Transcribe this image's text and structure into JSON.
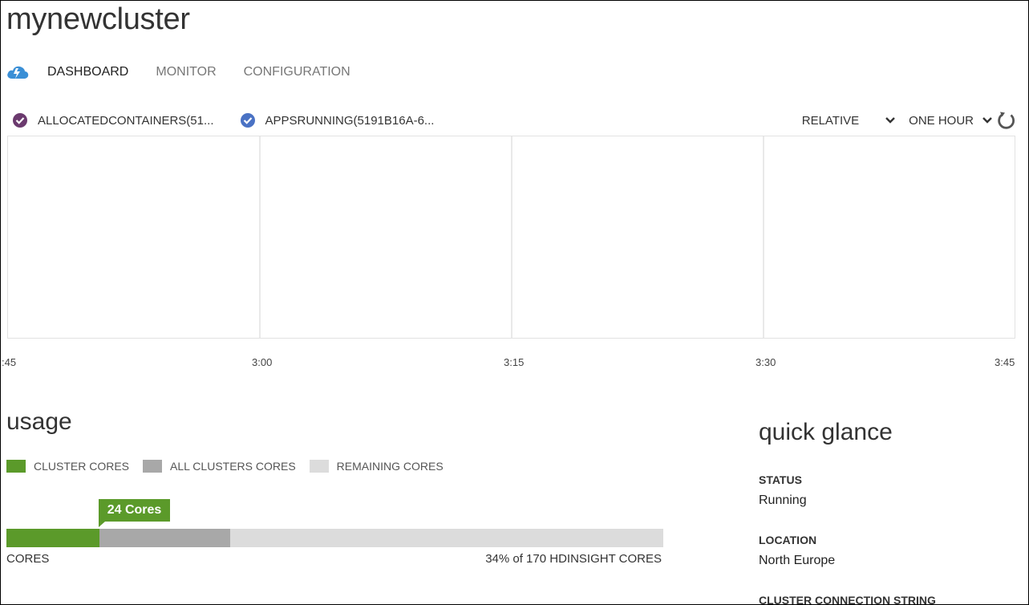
{
  "cluster": {
    "name": "mynewcluster"
  },
  "nav": {
    "tabs": [
      {
        "label": "DASHBOARD",
        "active": true
      },
      {
        "label": "MONITOR",
        "active": false
      },
      {
        "label": "CONFIGURATION",
        "active": false
      }
    ]
  },
  "metrics": [
    {
      "label": "ALLOCATEDCONTAINERS(51...",
      "color": "#6b3a6e"
    },
    {
      "label": "APPSRUNNING(5191B16A-6...",
      "color": "#4a72c4"
    }
  ],
  "controls": {
    "scale": "RELATIVE",
    "range": "ONE HOUR",
    "refresh_icon": "refresh-icon"
  },
  "chart_data": {
    "type": "line",
    "x_ticks": [
      ":45",
      "3:00",
      "3:15",
      "3:30",
      "3:45"
    ],
    "series": [],
    "grid": true
  },
  "usage": {
    "title": "usage",
    "legend": [
      {
        "label": "CLUSTER CORES",
        "color": "#5b9a2a"
      },
      {
        "label": "ALL CLUSTERS CORES",
        "color": "#a8a8a8"
      },
      {
        "label": "REMAINING CORES",
        "color": "#dcdcdc"
      }
    ],
    "callout": "24 Cores",
    "cluster_cores": 24,
    "all_clusters_cores": 58,
    "total_cores": 170,
    "cores_label": "CORES",
    "summary": "34% of 170 HDINSIGHT CORES"
  },
  "quick_glance": {
    "title": "quick glance",
    "items": [
      {
        "label": "STATUS",
        "value": "Running"
      },
      {
        "label": "LOCATION",
        "value": "North Europe"
      },
      {
        "label": "CLUSTER CONNECTION STRING",
        "value": ""
      }
    ]
  }
}
